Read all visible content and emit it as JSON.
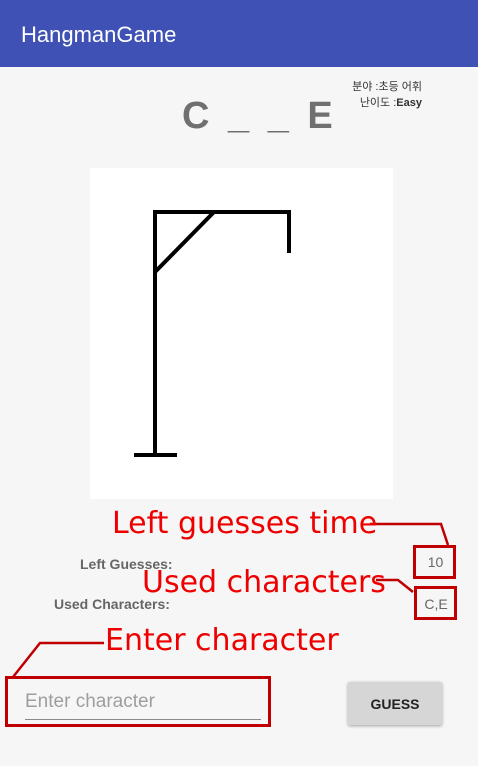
{
  "app_bar": {
    "title": "HangmanGame"
  },
  "category": {
    "field_label": "분야 :",
    "field_value": "초등 어휘",
    "difficulty_label": "난이도 :",
    "difficulty_value": "Easy"
  },
  "word_display": "C _ _ E",
  "stats": {
    "left_guesses_label": "Left Guesses:",
    "left_guesses_value": "10",
    "used_characters_label": "Used Characters:",
    "used_characters_value": "C,E"
  },
  "input": {
    "placeholder": "Enter character",
    "value": ""
  },
  "guess_button": {
    "label": "GUESS"
  },
  "annotations": {
    "left_guesses": "Left guesses time",
    "used_characters": "Used characters",
    "enter_character": "Enter character"
  },
  "colors": {
    "app_bar": "#3f51b5",
    "annotation": "#ee0000",
    "annotation_box": "#c00000",
    "background": "#f6f6f6"
  }
}
